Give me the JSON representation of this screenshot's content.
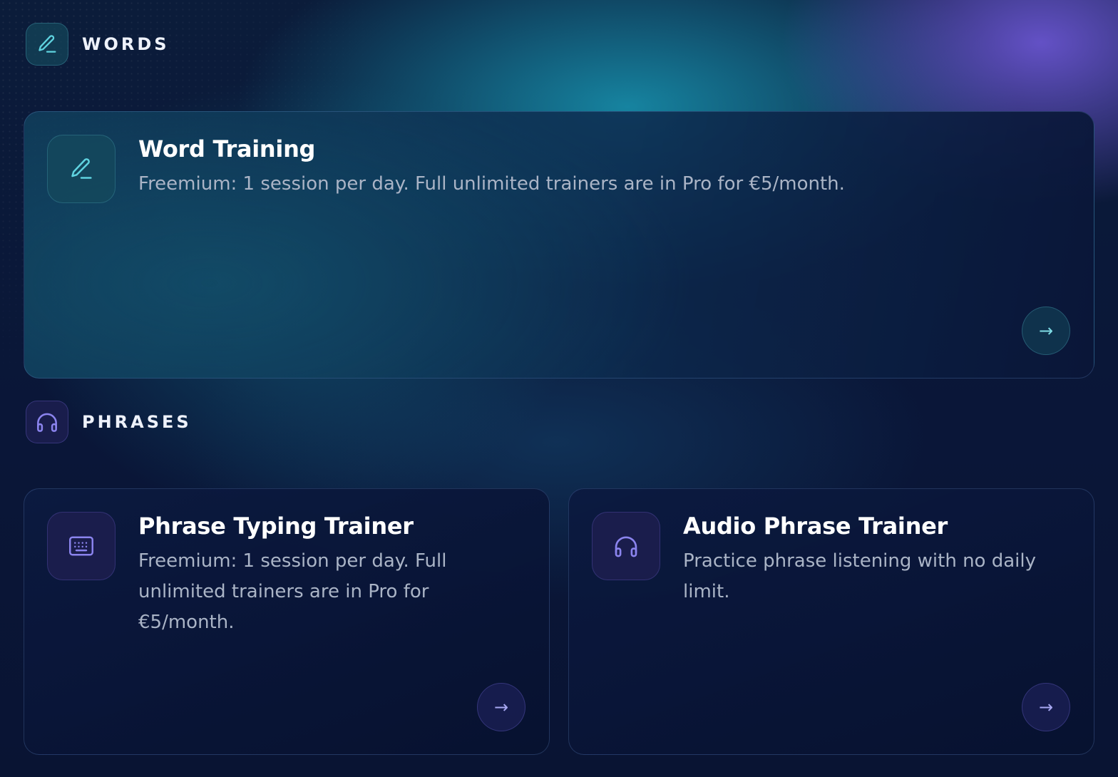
{
  "sections": {
    "words": {
      "title": "WORDS",
      "icon": "pencil-icon"
    },
    "phrases": {
      "title": "PHRASES",
      "icon": "headphones-icon"
    }
  },
  "cards": {
    "word_training": {
      "title": "Word Training",
      "description": "Freemium: 1 session per day. Full unlimited trainers are in Pro for €5/month.",
      "icon": "pencil-icon",
      "arrow": "→"
    },
    "phrase_typing": {
      "title": "Phrase Typing Trainer",
      "description": "Freemium: 1 session per day. Full unlimited trainers are in Pro for €5/month.",
      "icon": "keyboard-icon",
      "arrow": "→"
    },
    "audio_phrase": {
      "title": "Audio Phrase Trainer",
      "description": "Practice phrase listening with no daily limit.",
      "icon": "headphones-icon",
      "arrow": "→"
    }
  },
  "colors": {
    "teal_accent": "#5fd3e0",
    "violet_accent": "#8b84ee",
    "background": "#0a1738"
  }
}
